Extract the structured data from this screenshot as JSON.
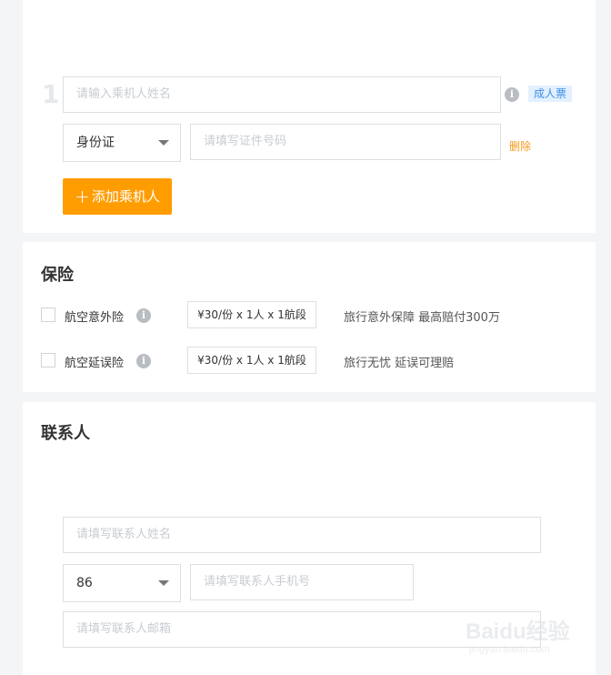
{
  "passenger": {
    "number": "1",
    "name_placeholder": "请输入乘机人姓名",
    "ticket_type": "成人票",
    "id_type": "身份证",
    "id_placeholder": "请填写证件号码",
    "delete_label": "删除",
    "add_label": "添加乘机人",
    "add_icon": "+"
  },
  "insurance": {
    "title": "保险",
    "items": [
      {
        "name": "航空意外险",
        "price": "¥30/份 x 1人 x 1航段",
        "desc": "旅行意外保障  最高赔付300万",
        "checked": false
      },
      {
        "name": "航空延误险",
        "price": "¥30/份 x 1人 x 1航段",
        "desc": "旅行无忧  延误可理赔",
        "checked": false
      }
    ]
  },
  "contact": {
    "title": "联系人",
    "name_placeholder": "请填写联系人姓名",
    "country_code": "86",
    "phone_placeholder": "请填写联系人手机号",
    "email_placeholder": "请填写联系人邮箱"
  },
  "watermark": {
    "text": "Baidu经验",
    "sub": "jingyan.baidu.com"
  },
  "colors": {
    "accent_orange": "#ff9d00",
    "tag_blue": "#3e8fe8",
    "border": "#dcdfe3",
    "background": "#f3f5f7"
  },
  "icons": {
    "info": "info-icon",
    "caret": "caret-down-icon",
    "plus": "plus-icon"
  }
}
